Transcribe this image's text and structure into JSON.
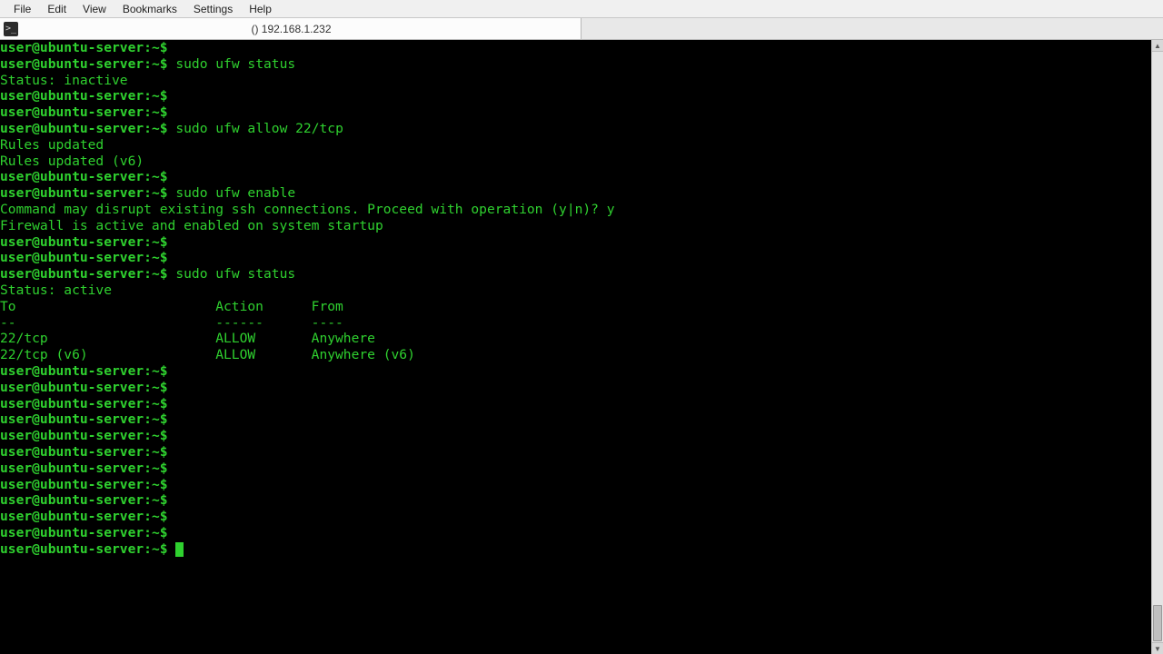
{
  "menubar": {
    "items": [
      "File",
      "Edit",
      "View",
      "Bookmarks",
      "Settings",
      "Help"
    ]
  },
  "tab": {
    "icon_glyph": ">_",
    "title": "() 192.168.1.232"
  },
  "prompt": {
    "user": "user",
    "host": "ubuntu-server",
    "path": "~",
    "symbol": "$"
  },
  "session": [
    {
      "type": "prompt",
      "cmd": ""
    },
    {
      "type": "prompt",
      "cmd": "sudo ufw status"
    },
    {
      "type": "output",
      "text": "Status: inactive"
    },
    {
      "type": "prompt",
      "cmd": ""
    },
    {
      "type": "prompt",
      "cmd": ""
    },
    {
      "type": "prompt",
      "cmd": "sudo ufw allow 22/tcp"
    },
    {
      "type": "output",
      "text": "Rules updated"
    },
    {
      "type": "output",
      "text": "Rules updated (v6)"
    },
    {
      "type": "prompt",
      "cmd": ""
    },
    {
      "type": "prompt",
      "cmd": "sudo ufw enable"
    },
    {
      "type": "output",
      "text": "Command may disrupt existing ssh connections. Proceed with operation (y|n)? y"
    },
    {
      "type": "output",
      "text": "Firewall is active and enabled on system startup"
    },
    {
      "type": "prompt",
      "cmd": ""
    },
    {
      "type": "prompt",
      "cmd": ""
    },
    {
      "type": "prompt",
      "cmd": "sudo ufw status"
    },
    {
      "type": "output",
      "text": "Status: active"
    },
    {
      "type": "output",
      "text": ""
    },
    {
      "type": "output",
      "text": "To                         Action      From"
    },
    {
      "type": "output",
      "text": "--                         ------      ----"
    },
    {
      "type": "output",
      "text": "22/tcp                     ALLOW       Anywhere"
    },
    {
      "type": "output",
      "text": "22/tcp (v6)                ALLOW       Anywhere (v6)"
    },
    {
      "type": "output",
      "text": ""
    },
    {
      "type": "prompt",
      "cmd": ""
    },
    {
      "type": "prompt",
      "cmd": ""
    },
    {
      "type": "prompt",
      "cmd": ""
    },
    {
      "type": "prompt",
      "cmd": ""
    },
    {
      "type": "prompt",
      "cmd": ""
    },
    {
      "type": "prompt",
      "cmd": ""
    },
    {
      "type": "prompt",
      "cmd": ""
    },
    {
      "type": "prompt",
      "cmd": ""
    },
    {
      "type": "prompt",
      "cmd": ""
    },
    {
      "type": "prompt",
      "cmd": ""
    },
    {
      "type": "prompt",
      "cmd": ""
    },
    {
      "type": "prompt",
      "cmd": "",
      "cursor": true
    }
  ],
  "colors": {
    "term_fg": "#2fd12f",
    "term_bg": "#000000"
  }
}
